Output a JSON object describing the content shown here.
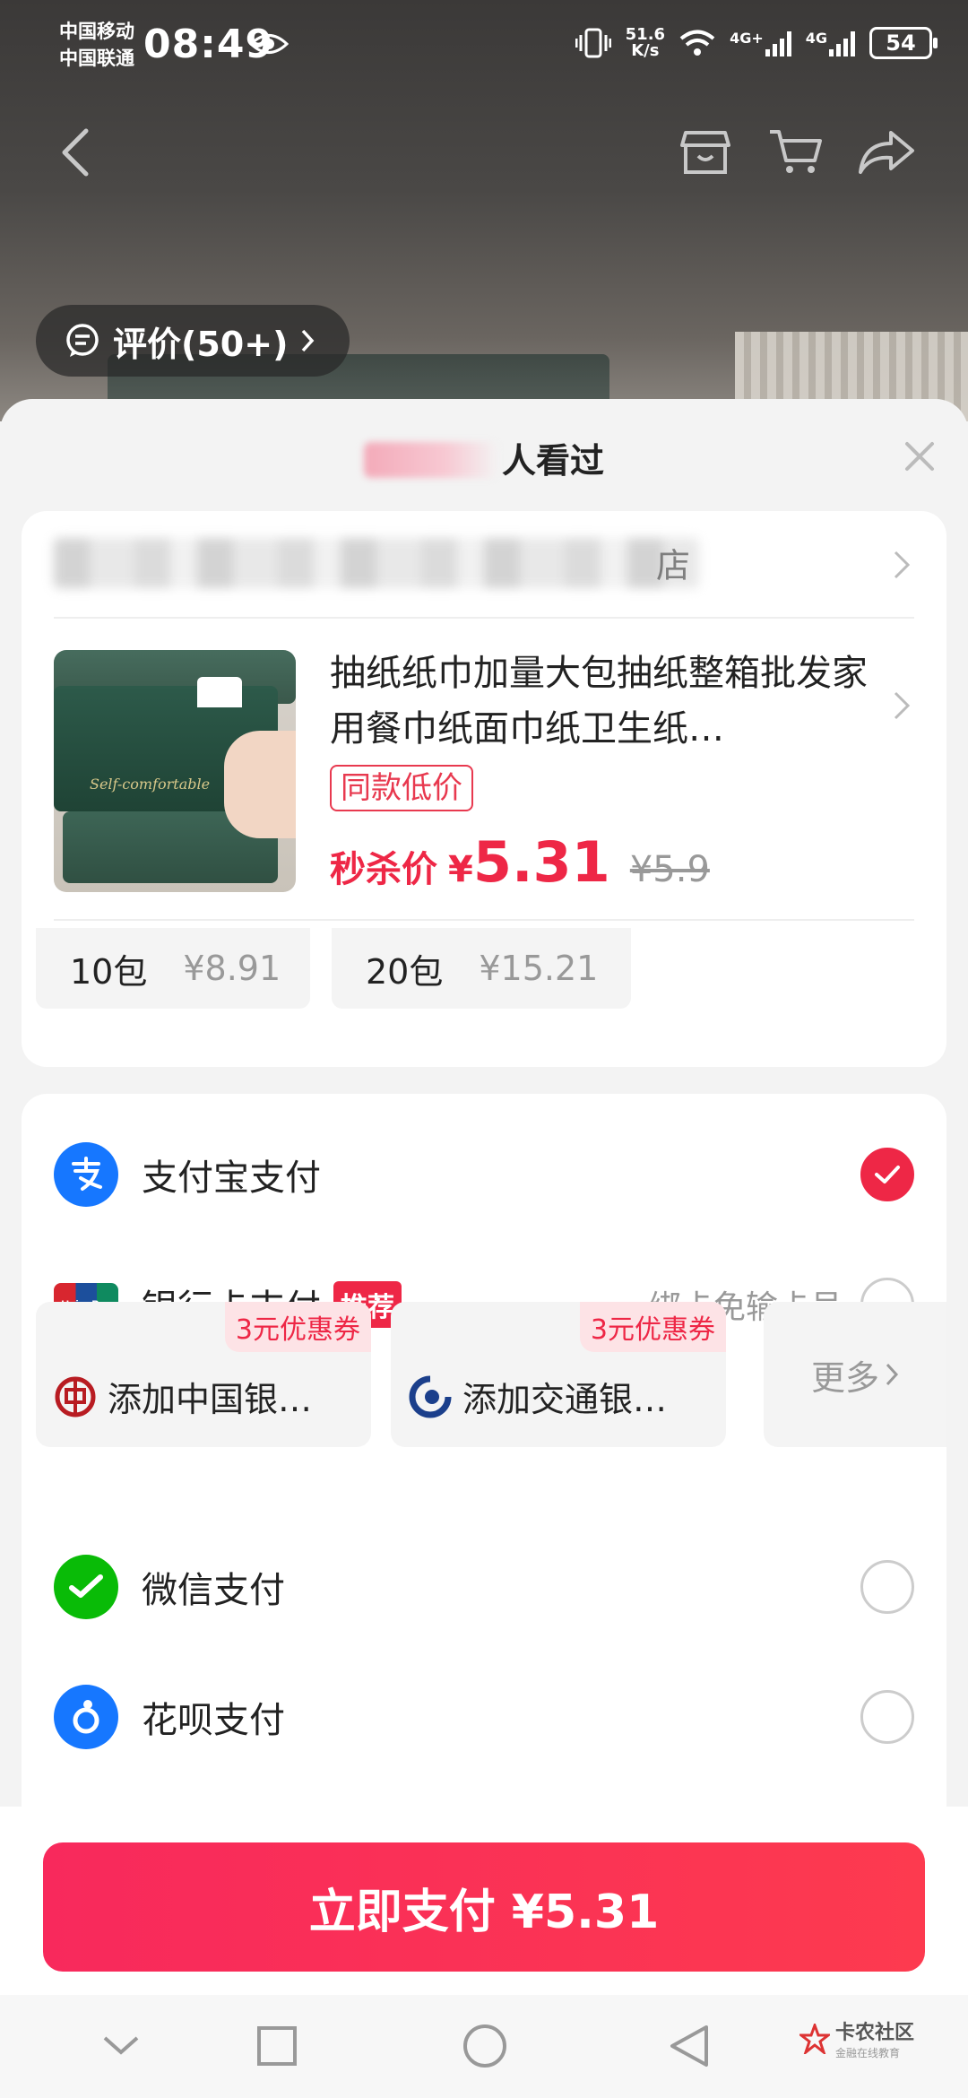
{
  "status_bar": {
    "carrier1": "中国移动",
    "carrier2": "中国联通",
    "time": "08:49",
    "speed_value": "51.6",
    "speed_unit": "K/s",
    "net1": "4G+",
    "net2": "4G",
    "battery": "54"
  },
  "review_pill": {
    "label": "评价(50+)"
  },
  "sheet": {
    "viewers_label": "人看过",
    "viewers_count_partial": "8千+"
  },
  "product": {
    "store_name_partial": "店",
    "title": "抽纸纸巾加量大包抽纸整箱批发家用餐巾纸面巾纸卫生纸…",
    "tag": "同款低价",
    "price_label": "秒杀价",
    "currency": "¥",
    "price": "5.31",
    "original_price": "¥5.9",
    "thumb_caption": "Self-comfortable",
    "specs": [
      {
        "name": "10包",
        "price": "¥8.91"
      },
      {
        "name": "20包",
        "price": "¥15.21"
      }
    ]
  },
  "payment": {
    "alipay": {
      "name": "支付宝支付",
      "selected": true
    },
    "bankcard": {
      "name": "银行卡支付",
      "badge": "推荐",
      "hint": "绑卡免输卡号"
    },
    "banks": [
      {
        "name": "添加中国银…",
        "coupon": "3元优惠券"
      },
      {
        "name": "添加交通银…",
        "coupon": "3元优惠券"
      }
    ],
    "more": "更多",
    "wechat": {
      "name": "微信支付"
    },
    "huabei": {
      "name": "花呗支付"
    }
  },
  "footer": {
    "pay_button": "立即支付 ¥5.31"
  },
  "watermark": {
    "name": "卡农社区",
    "sub": "金融在线教育"
  },
  "colors": {
    "accent": "#ee2746",
    "alipay": "#1677ff",
    "wechat": "#09bb07"
  }
}
